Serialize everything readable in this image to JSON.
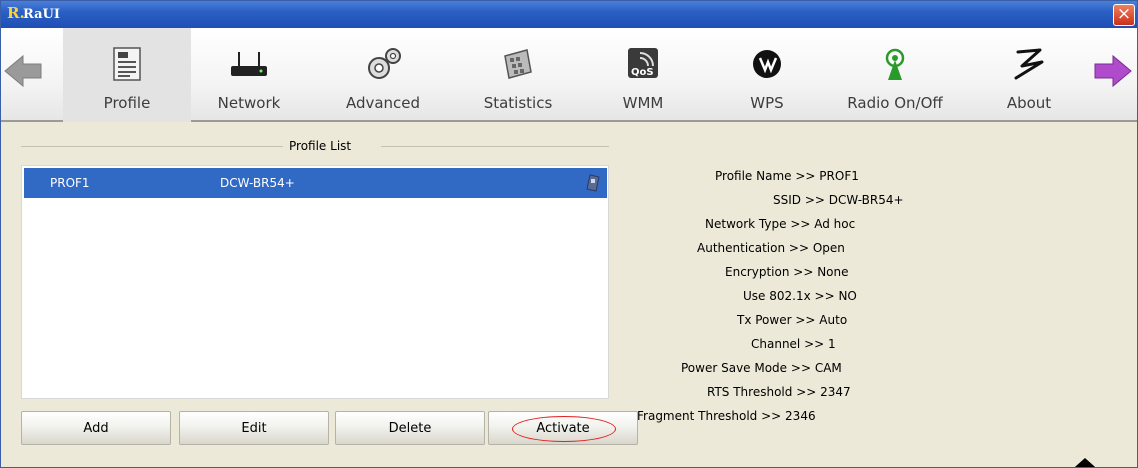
{
  "window": {
    "title": "RaUI",
    "logo": "R."
  },
  "close_label": "×",
  "toolbar": {
    "items": [
      {
        "label": "Profile",
        "icon": "profile-icon"
      },
      {
        "label": "Network",
        "icon": "network-icon"
      },
      {
        "label": "Advanced",
        "icon": "advanced-icon"
      },
      {
        "label": "Statistics",
        "icon": "statistics-icon"
      },
      {
        "label": "WMM",
        "icon": "wmm-icon"
      },
      {
        "label": "WPS",
        "icon": "wps-icon"
      },
      {
        "label": "Radio On/Off",
        "icon": "radio-icon"
      },
      {
        "label": "About",
        "icon": "about-icon"
      }
    ],
    "active": "Profile"
  },
  "profile_list": {
    "title": "Profile List",
    "rows": [
      {
        "name": "PROF1",
        "ssid": "DCW-BR54+",
        "selected": true
      }
    ]
  },
  "buttons": {
    "add": "Add",
    "edit": "Edit",
    "delete": "Delete",
    "activate": "Activate"
  },
  "details": [
    {
      "key": "Profile Name",
      "sep": ">>",
      "value": "PROF1"
    },
    {
      "key": "SSID",
      "sep": ">>",
      "value": "DCW-BR54+"
    },
    {
      "key": "Network Type",
      "sep": ">>",
      "value": "Ad hoc"
    },
    {
      "key": "Authentication",
      "sep": ">>",
      "value": "Open"
    },
    {
      "key": "Encryption",
      "sep": ">>",
      "value": "None"
    },
    {
      "key": "Use 802.1x",
      "sep": ">>",
      "value": "NO"
    },
    {
      "key": "Tx Power",
      "sep": ">>",
      "value": "Auto"
    },
    {
      "key": "Channel",
      "sep": ">>",
      "value": "1"
    },
    {
      "key": "Power Save Mode",
      "sep": ">>",
      "value": "CAM"
    },
    {
      "key": "RTS Threshold",
      "sep": ">>",
      "value": "2347"
    },
    {
      "key": "Fragment Threshold",
      "sep": ">>",
      "value": "2346"
    }
  ],
  "colors": {
    "titlebar": "#2a5fc4",
    "selection": "#316ac5",
    "accent_ring": "#e02020",
    "panel_bg": "#ece9d8"
  }
}
